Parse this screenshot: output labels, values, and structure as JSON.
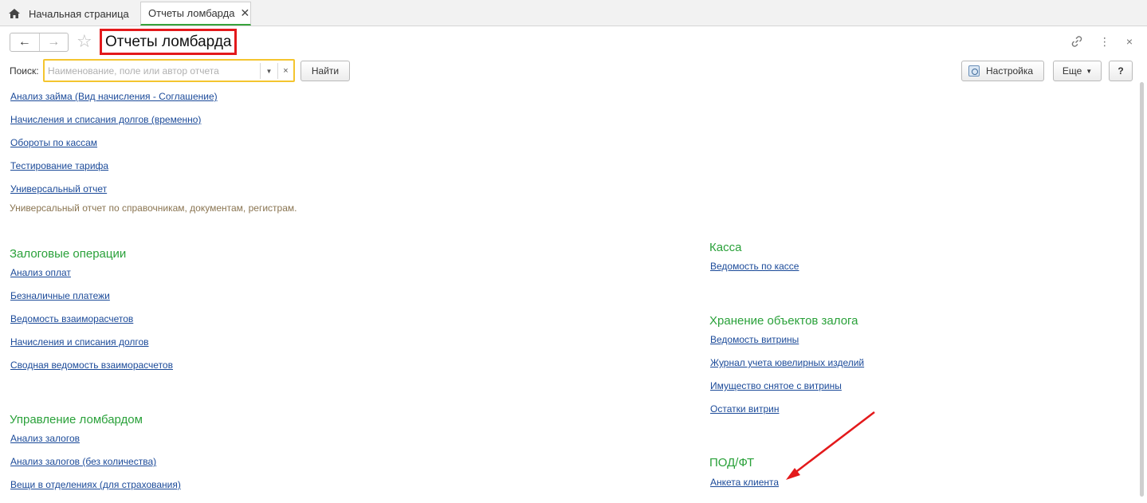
{
  "tabs": {
    "home_label": "Начальная страница",
    "active_label": "Отчеты ломбарда",
    "close_glyph": "✕"
  },
  "header": {
    "title": "Отчеты ломбарда",
    "back_glyph": "←",
    "forward_glyph": "→",
    "star_glyph": "☆",
    "link_icon": "link-icon",
    "more_glyph": "⋮",
    "close_glyph": "×"
  },
  "search": {
    "label": "Поиск:",
    "placeholder": "Наименование, поле или автор отчета",
    "value": "",
    "dropdown_glyph": "▼",
    "clear_glyph": "×",
    "find_label": "Найти"
  },
  "toolbar": {
    "settings_label": "Настройка",
    "more_label": "Еще",
    "more_caret": "▼",
    "help_label": "?"
  },
  "ungrouped": {
    "items": [
      "Анализ займа (Вид начисления - Соглашение)",
      "Начисления и списания долгов (временно)",
      "Обороты по кассам",
      "Тестирование тарифа",
      "Универсальный отчет"
    ],
    "universal_description": "Универсальный отчет по справочникам, документам, регистрам."
  },
  "groups": {
    "pledge": {
      "title": "Залоговые операции",
      "items": [
        "Анализ оплат",
        "Безналичные платежи",
        "Ведомость взаиморасчетов",
        "Начисления и списания долгов",
        "Сводная ведомость взаиморасчетов"
      ]
    },
    "management": {
      "title": "Управление ломбардом",
      "items": [
        "Анализ залогов",
        "Анализ залогов (без количества)",
        "Вещи в отделениях (для страхования)"
      ]
    },
    "cash": {
      "title": "Касса",
      "items": [
        "Ведомость по кассе"
      ]
    },
    "storage": {
      "title": "Хранение объектов залога",
      "items": [
        "Ведомость витрины",
        "Журнал учета ювелирных изделий",
        "Имущество снятое с витрины",
        "Остатки витрин"
      ]
    },
    "aml": {
      "title": "ПОД/ФТ",
      "items": [
        "Анкета клиента"
      ]
    }
  },
  "colors": {
    "link": "#1b4a99",
    "group_title": "#2aa13a",
    "description": "#8a7552",
    "highlight": "#e3191b",
    "search_focus": "#f4c52f",
    "active_tab_underline": "#38a33b"
  }
}
